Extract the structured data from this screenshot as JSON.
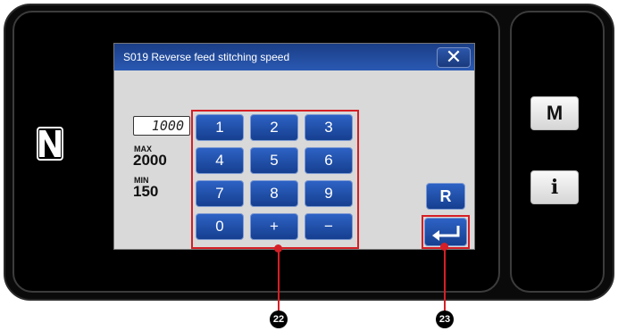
{
  "dialog": {
    "title": "S019 Reverse feed stitching speed",
    "close_label": "✕"
  },
  "value": {
    "current": "1000",
    "max_label": "MAX",
    "max_value": "2000",
    "min_label": "MIN",
    "min_value": "150"
  },
  "keypad": {
    "k1": "1",
    "k2": "2",
    "k3": "3",
    "k4": "4",
    "k5": "5",
    "k6": "6",
    "k7": "7",
    "k8": "8",
    "k9": "9",
    "k0": "0",
    "plus": "+",
    "minus": "−"
  },
  "buttons": {
    "reset": "R",
    "menu": "M",
    "info": "i"
  },
  "callouts": {
    "keypad": "22",
    "enter": "23"
  },
  "colors": {
    "title_bar": "#2a59b3",
    "key_blue": "#2d62c5",
    "highlight_red": "#d51f26",
    "dialog_bg": "#d9d9d9"
  }
}
